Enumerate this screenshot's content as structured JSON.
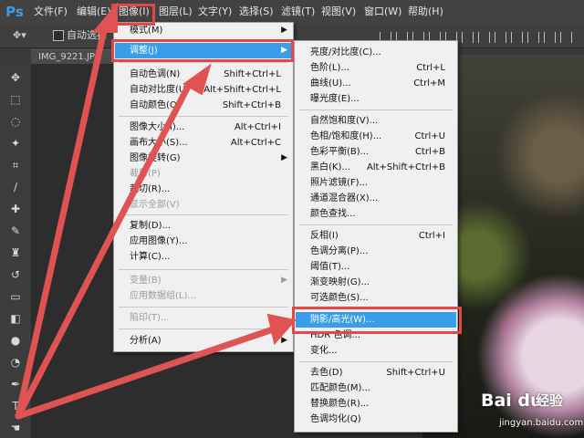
{
  "app": {
    "logo": "Ps"
  },
  "menubar": [
    "文件(F)",
    "编辑(E)",
    "图像(I)",
    "图层(L)",
    "文字(Y)",
    "选择(S)",
    "滤镜(T)",
    "视图(V)",
    "窗口(W)",
    "帮助(H)"
  ],
  "options": {
    "auto_select": "自动选择"
  },
  "document": {
    "tab": "IMG_9221.JP"
  },
  "image_menu": [
    {
      "label": "模式(M)",
      "shortcut": "",
      "arrow": true,
      "disabled": false
    },
    {
      "label": "调整(J)",
      "shortcut": "",
      "arrow": true,
      "disabled": false,
      "highlight": true
    },
    {
      "label": "自动色调(N)",
      "shortcut": "Shift+Ctrl+L",
      "arrow": false,
      "disabled": false
    },
    {
      "label": "自动对比度(U)",
      "shortcut": "Alt+Shift+Ctrl+L",
      "arrow": false,
      "disabled": false
    },
    {
      "label": "自动颜色(O)",
      "shortcut": "Shift+Ctrl+B",
      "arrow": false,
      "disabled": false
    },
    {
      "label": "图像大小(I)...",
      "shortcut": "Alt+Ctrl+I",
      "arrow": false,
      "disabled": false
    },
    {
      "label": "画布大小(S)...",
      "shortcut": "Alt+Ctrl+C",
      "arrow": false,
      "disabled": false
    },
    {
      "label": "图像旋转(G)",
      "shortcut": "",
      "arrow": true,
      "disabled": false
    },
    {
      "label": "裁剪(P)",
      "shortcut": "",
      "arrow": false,
      "disabled": true
    },
    {
      "label": "裁切(R)...",
      "shortcut": "",
      "arrow": false,
      "disabled": false
    },
    {
      "label": "显示全部(V)",
      "shortcut": "",
      "arrow": false,
      "disabled": true
    },
    {
      "label": "复制(D)...",
      "shortcut": "",
      "arrow": false,
      "disabled": false
    },
    {
      "label": "应用图像(Y)...",
      "shortcut": "",
      "arrow": false,
      "disabled": false
    },
    {
      "label": "计算(C)...",
      "shortcut": "",
      "arrow": false,
      "disabled": false
    },
    {
      "label": "变量(B)",
      "shortcut": "",
      "arrow": true,
      "disabled": true
    },
    {
      "label": "应用数据组(L)...",
      "shortcut": "",
      "arrow": false,
      "disabled": true
    },
    {
      "label": "陷印(T)...",
      "shortcut": "",
      "arrow": false,
      "disabled": true
    },
    {
      "label": "分析(A)",
      "shortcut": "",
      "arrow": true,
      "disabled": false
    }
  ],
  "adjust_menu": [
    {
      "label": "亮度/对比度(C)...",
      "shortcut": ""
    },
    {
      "label": "色阶(L)...",
      "shortcut": "Ctrl+L"
    },
    {
      "label": "曲线(U)...",
      "shortcut": "Ctrl+M"
    },
    {
      "label": "曝光度(E)...",
      "shortcut": ""
    },
    {
      "label": "自然饱和度(V)...",
      "shortcut": ""
    },
    {
      "label": "色相/饱和度(H)...",
      "shortcut": "Ctrl+U"
    },
    {
      "label": "色彩平衡(B)...",
      "shortcut": "Ctrl+B"
    },
    {
      "label": "黑白(K)...",
      "shortcut": "Alt+Shift+Ctrl+B"
    },
    {
      "label": "照片滤镜(F)...",
      "shortcut": ""
    },
    {
      "label": "通道混合器(X)...",
      "shortcut": ""
    },
    {
      "label": "颜色查找...",
      "shortcut": ""
    },
    {
      "label": "反相(I)",
      "shortcut": "Ctrl+I"
    },
    {
      "label": "色调分离(P)...",
      "shortcut": ""
    },
    {
      "label": "阈值(T)...",
      "shortcut": ""
    },
    {
      "label": "渐变映射(G)...",
      "shortcut": ""
    },
    {
      "label": "可选颜色(S)...",
      "shortcut": ""
    },
    {
      "label": "阴影/高光(W)...",
      "shortcut": "",
      "highlight": true
    },
    {
      "label": "HDR 色调...",
      "shortcut": ""
    },
    {
      "label": "变化...",
      "shortcut": ""
    },
    {
      "label": "去色(D)",
      "shortcut": "Shift+Ctrl+U"
    },
    {
      "label": "匹配颜色(M)...",
      "shortcut": ""
    },
    {
      "label": "替换颜色(R)...",
      "shortcut": ""
    },
    {
      "label": "色调均化(Q)",
      "shortcut": ""
    }
  ],
  "watermark": {
    "logo": "Bai du",
    "title": "经验",
    "url": "jingyan.baidu.com"
  }
}
